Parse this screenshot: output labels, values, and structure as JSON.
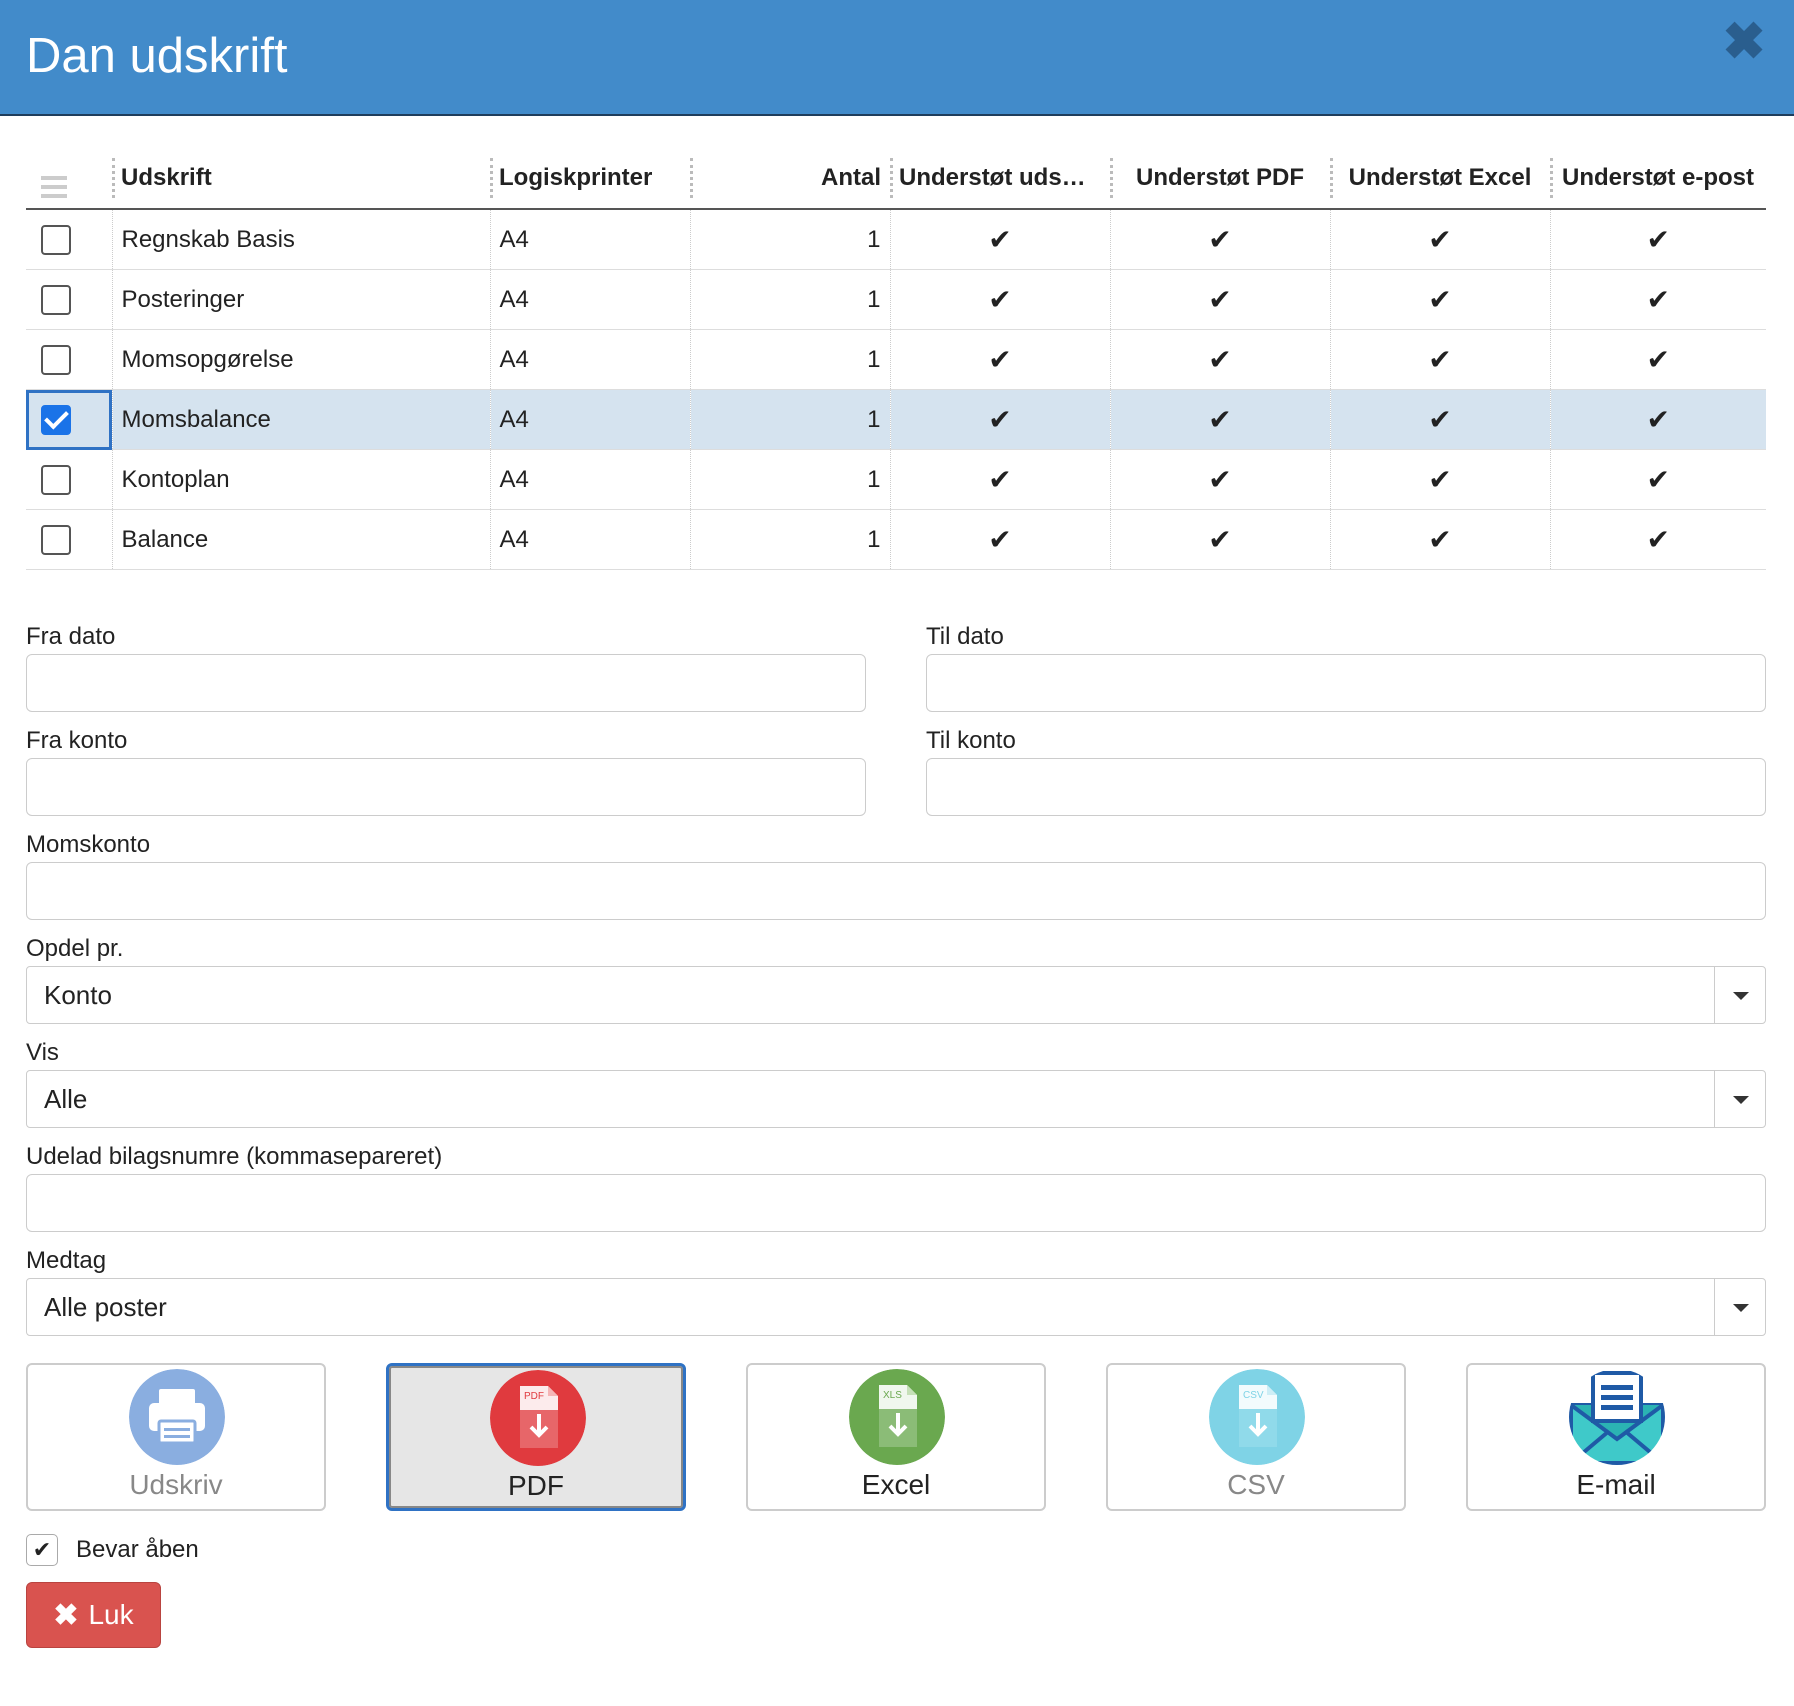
{
  "dialog": {
    "title": "Dan udskrift",
    "close_glyph": "✖"
  },
  "table": {
    "columns": [
      "Udskrift",
      "Logiskprinter",
      "Antal",
      "Understøt uds…",
      "Understøt PDF",
      "Understøt Excel",
      "Understøt e-post"
    ],
    "check_glyph": "✔",
    "rows": [
      {
        "checked": false,
        "name": "Regnskab Basis",
        "printer": "A4",
        "antal": "1"
      },
      {
        "checked": false,
        "name": "Posteringer",
        "printer": "A4",
        "antal": "1"
      },
      {
        "checked": false,
        "name": "Momsopgørelse",
        "printer": "A4",
        "antal": "1"
      },
      {
        "checked": true,
        "name": "Momsbalance",
        "printer": "A4",
        "antal": "1"
      },
      {
        "checked": false,
        "name": "Kontoplan",
        "printer": "A4",
        "antal": "1"
      },
      {
        "checked": false,
        "name": "Balance",
        "printer": "A4",
        "antal": "1"
      }
    ]
  },
  "form": {
    "fra_dato": {
      "label": "Fra dato",
      "value": ""
    },
    "til_dato": {
      "label": "Til dato",
      "value": ""
    },
    "fra_konto": {
      "label": "Fra konto",
      "value": ""
    },
    "til_konto": {
      "label": "Til konto",
      "value": ""
    },
    "momskonto": {
      "label": "Momskonto",
      "value": ""
    },
    "opdel": {
      "label": "Opdel pr.",
      "value": "Konto"
    },
    "vis": {
      "label": "Vis",
      "value": "Alle"
    },
    "udelad": {
      "label": "Udelad bilagsnumre (kommasepareret)",
      "value": ""
    },
    "medtag": {
      "label": "Medtag",
      "value": "Alle poster"
    }
  },
  "actions": {
    "udskriv": "Udskriv",
    "pdf": "PDF",
    "excel": "Excel",
    "csv": "CSV",
    "email": "E-mail",
    "pdf_badge": "PDF",
    "xls_badge": "XLS",
    "csv_badge": "CSV"
  },
  "keep_open": {
    "label": "Bevar åben",
    "checked": true,
    "glyph": "✔"
  },
  "close_button": {
    "label": "Luk",
    "glyph": "✖"
  },
  "colors": {
    "header": "#428bca",
    "pdf": "#e03a3e",
    "excel": "#6aa84f",
    "csv": "#7fd3e6",
    "print": "#8aaee0",
    "email": "#1f5aa6",
    "danger": "#d9534f"
  }
}
